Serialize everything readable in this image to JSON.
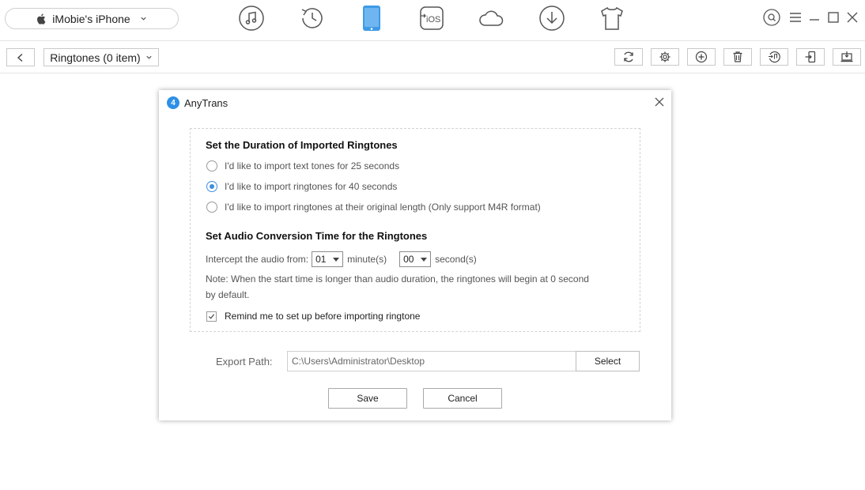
{
  "topbar": {
    "device_name": "iMobie's iPhone",
    "nav_icons": [
      "music-icon",
      "history-icon",
      "phone-icon",
      "ios-mover-icon",
      "icloud-icon",
      "download-icon",
      "shirt-icon"
    ],
    "ios_label": "iOS",
    "accent": "#3e9ae6"
  },
  "subbar": {
    "category_label": "Ringtones (0 item)",
    "tools": [
      "refresh-icon",
      "settings-icon",
      "add-icon",
      "delete-icon",
      "to-itunes-icon",
      "to-device-icon",
      "to-computer-icon"
    ]
  },
  "dialog": {
    "title": "AnyTrans",
    "logo_char": "4",
    "section1_title": "Set the Duration of Imported Ringtones",
    "radio_options": [
      {
        "label": "I'd like to import text tones for 25 seconds",
        "checked": false
      },
      {
        "label": "I'd like to import ringtones for 40 seconds",
        "checked": true
      },
      {
        "label": "I'd like to import ringtones at their original length (Only support M4R format)",
        "checked": false
      }
    ],
    "section2_title": "Set Audio Conversion Time for the Ringtones",
    "intercept_label": "Intercept the audio from:",
    "minute_value": "01",
    "minute_unit": "minute(s)",
    "second_value": "00",
    "second_unit": "second(s)",
    "note": "Note: When the start time is longer than audio duration, the ringtones will begin at 0 second by default.",
    "remind_label": "Remind me to set up before importing ringtone",
    "remind_checked": true,
    "export_label": "Export Path:",
    "export_path": "C:\\Users\\Administrator\\Desktop",
    "select_label": "Select",
    "save_label": "Save",
    "cancel_label": "Cancel"
  }
}
